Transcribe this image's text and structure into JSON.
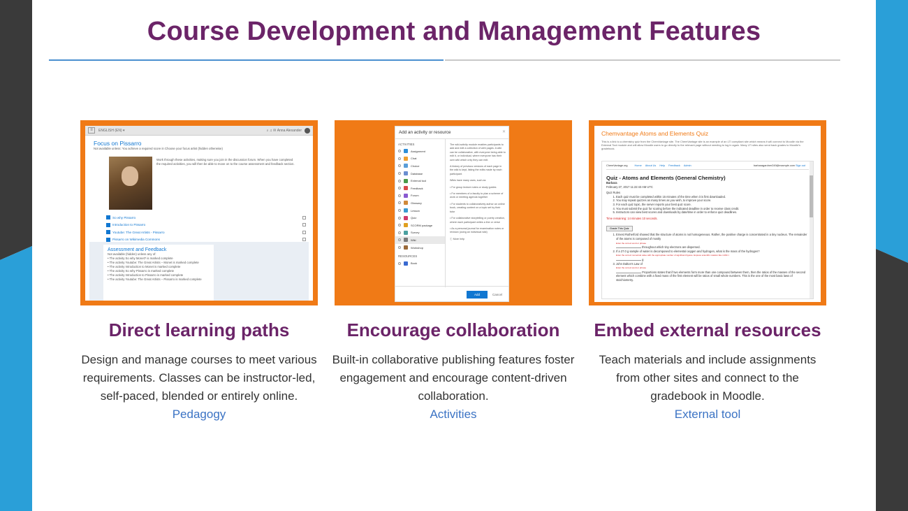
{
  "title": "Course Development and Management Features",
  "colors": {
    "title": "#6b2468",
    "accent_blue": "#2a9fd8",
    "dark_grey": "#3a3a3a",
    "link": "#3b73c4",
    "frame_orange": "#f07a16"
  },
  "features": [
    {
      "heading": "Direct learning paths",
      "description": "Design and manage courses to meet various requirements. Classes can be instructor-led, self-paced, blended or entirely online.",
      "link": "Pedagogy",
      "screenshot": {
        "topbar_lang": "ENGLISH (EN) ▾",
        "topbar_user": "Anna Alexander",
        "course_title": "Focus on Pissarro",
        "restriction": "Not available unless: You achieve a required score in Choose your focus artist (hidden otherwise)",
        "intro": "Work through these activities, making sure you join in the discussion forum. When you have completed the required activities, you will then be able to move on to the course assessment and feedback section.",
        "links": [
          "So why Pissarro",
          "Introduction to Pissarro",
          "Youtube: The Great Artists - Pissarro",
          "Pissarro on Wikimedia Commons"
        ],
        "section_title": "Assessment and Feedback",
        "section_note": "Not available (hidden) unless any of:",
        "conditions": [
          "• The activity So why Monet? is marked complete",
          "• The activity Youtube: The Great Artists – Monet is marked complete",
          "• The activity Introduction to Monet is marked complete",
          "• The activity So why Pissarro is marked complete",
          "• The activity Introduction to Pissarro is marked complete",
          "• The activity Youtube: The Great Artists – Pissarro is marked complete"
        ]
      }
    },
    {
      "heading": "Encourage collaboration",
      "description": "Built-in collaborative publishing features foster engagement and encourage content-driven collaboration.",
      "link": "Activities",
      "screenshot": {
        "modal_title": "Add an activity or resource",
        "activities_label": "ACTIVITIES",
        "resources_label": "RESOURCES",
        "activities": [
          "Assignment",
          "Chat",
          "Choice",
          "Database",
          "External tool",
          "Feedback",
          "Forum",
          "Glossary",
          "Lesson",
          "Quiz",
          "SCORM package",
          "Survey",
          "Wiki",
          "Workshop"
        ],
        "activity_colors": [
          "#2f8fd8",
          "#f0a030",
          "#5a9ed8",
          "#6a8ed0",
          "#4a9a4a",
          "#d84a4a",
          "#8a5ad0",
          "#d08a3a",
          "#3a9ad0",
          "#d03a6a",
          "#e0a020",
          "#4aa0a0",
          "#7a7a7a",
          "#9a6a3a"
        ],
        "resources": [
          "Book"
        ],
        "selected_index": 12,
        "desc_paragraphs": [
          "The wiki activity module enables participants to add and edit a collection of web pages. A wiki can be collaborative, with everyone being able to edit it, or individual, where everyone has their own wiki which only they can edit.",
          "A history of previous versions of each page in the wiki is kept, listing the edits made by each participant.",
          "Wikis have many uses, such as",
          "• For group lecture notes or study guides",
          "• For members of a faculty to plan a scheme of work or meeting agenda together",
          "• For students to collaboratively author an online book, creating content on a topic set by their tutor",
          "• For collaborative storytelling or poetry creation, where each participant writes a line or verse",
          "• As a personal journal for examination notes or revision (using an individual wiki)",
          "ⓘ More help"
        ],
        "add_label": "Add",
        "cancel_label": "Cancel"
      }
    },
    {
      "heading": "Embed external resources",
      "description": "Teach materials and include assignments from other sites and connect to the gradebook in Moodle.",
      "link": "External tool",
      "screenshot": {
        "page_title": "Chemvantage Atoms and Elements Quiz",
        "intro": "This is a link to a chemistry quiz from the ChemVantage site. The ChemVantage site is an example of an LTI compliant site which means it will connect to Moodle via the External Tool module and will allow Moodle users to go directly to the relevant page without needing to log in again. Many LTI sites also send back grades to Moodle's gradebook.",
        "nav_brand": "ChemVantage.org",
        "nav_items": [
          "Home",
          "About Us",
          "Help",
          "Feedback",
          "Admin"
        ],
        "nav_email": "barbaragardner249@example.com",
        "nav_signout": "Sign out",
        "quiz_title": "Quiz - Atoms and Elements (General Chemistry)",
        "student": "Barbara",
        "date": "February 27, 2017 11:22:43 AM UTC",
        "rules_label": "Quiz Rules",
        "rules": [
          "Each quiz must be completed within 15 minutes of the time when it is first downloaded.",
          "You may repeat quizzes as many times as you wish, to improve your score.",
          "For each quiz topic, the server reports your best quiz score.",
          "You must submit the quiz for scoring before the indicated deadline in order to receive class credit.",
          "Instructors can view best scores and downloads by date/time in order to enforce quiz deadlines."
        ],
        "time_remaining": "Time remaining: 14 minutes 10 seconds.",
        "grade_button": "Grade This Quiz",
        "q1": "Ernest Rutherford showed that the structure of atoms is not homogeneous. Rather, the positive charge is concentrated in a tiny nucleus. The remainder of the atoms is composed of mostly",
        "q1_hint": "Enter the correct word or phrase",
        "q1_tail": "throughout which tiny electrons are dispersed.",
        "q2": "If a 27.0 g sample of water is decomposed to elemental oxygen and hydrogen, what is the mass of the hydrogen?",
        "q2_hint": "Enter the correct numerical value with the appropriate number of significant figures. Express scientific notation like 4.294 ×",
        "q2_unit": "g",
        "q3": "John Dalton's Law of",
        "q3_hint": "Enter the correct word or phrase",
        "q3_tail": "Proportions states that if two elements form more than one compound between them, then the ratios of the masses of the second element which combine with a fixed mass of the first element will be ratios of small whole numbers. This is the one of the most basic laws of stoichiometry."
      }
    }
  ]
}
